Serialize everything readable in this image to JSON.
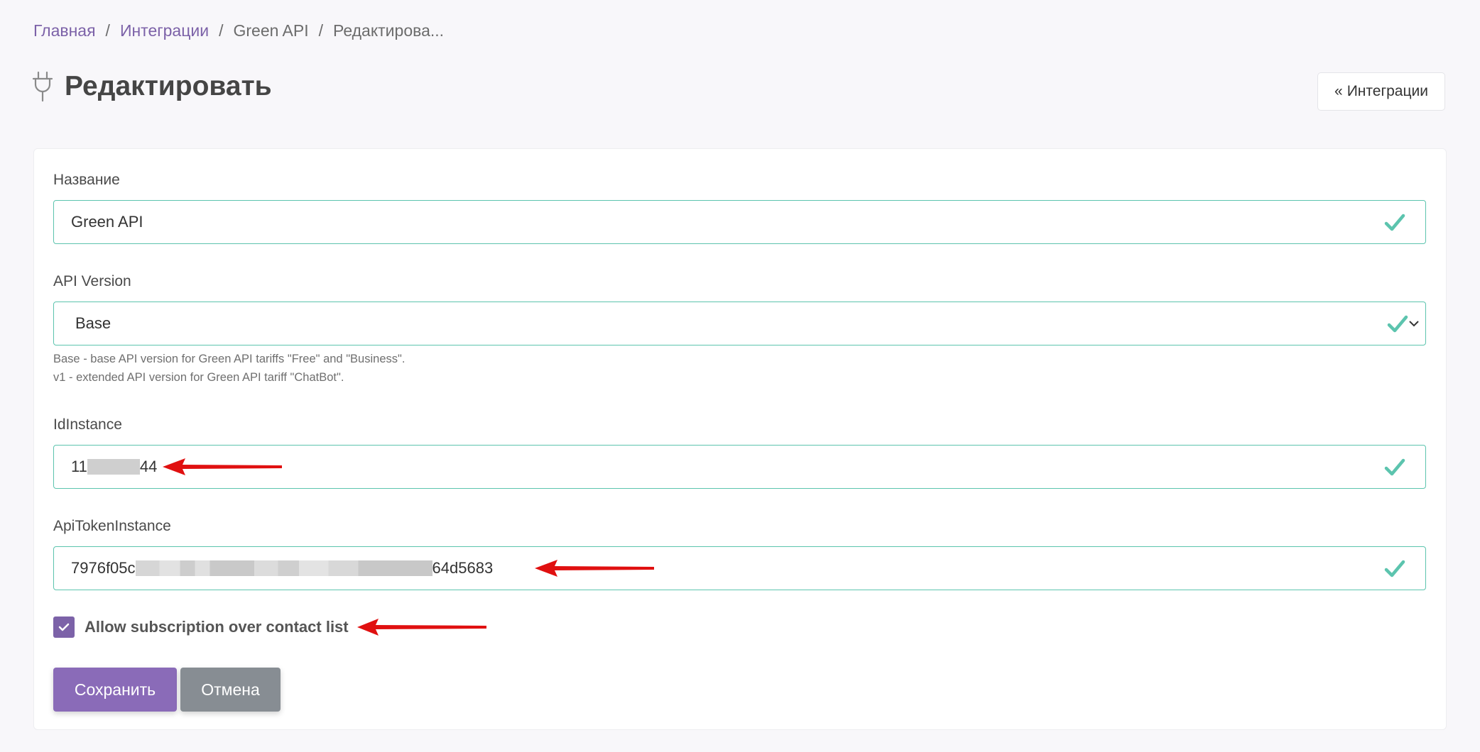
{
  "breadcrumb": {
    "home": "Главная",
    "integrations": "Интеграции",
    "item": "Green API",
    "current": "Редактирова..."
  },
  "header": {
    "title": "Редактировать",
    "icon": "plug-icon",
    "back_button": "Интеграции",
    "back_icon": "double-chevron-left-icon"
  },
  "form": {
    "name": {
      "label": "Название",
      "value": "Green API"
    },
    "api_version": {
      "label": "API Version",
      "value": "Base",
      "help_line1": "Base - base API version for Green API tariffs \"Free\" and \"Business\".",
      "help_line2": "v1 - extended API version for Green API tariff \"ChatBot\"."
    },
    "id_instance": {
      "label": "IdInstance",
      "value_prefix": "11",
      "value_suffix": "44"
    },
    "api_token": {
      "label": "ApiTokenInstance",
      "value_prefix": "7976f05c",
      "value_suffix": "64d5683"
    },
    "allow_subscription": {
      "label": "Allow subscription over contact list",
      "checked": true
    },
    "save_label": "Сохранить",
    "cancel_label": "Отмена"
  },
  "colors": {
    "accent": "#7c62a8",
    "valid_border": "#5cc4ae",
    "annotation_arrow": "#e01010",
    "cancel": "#878d93"
  }
}
